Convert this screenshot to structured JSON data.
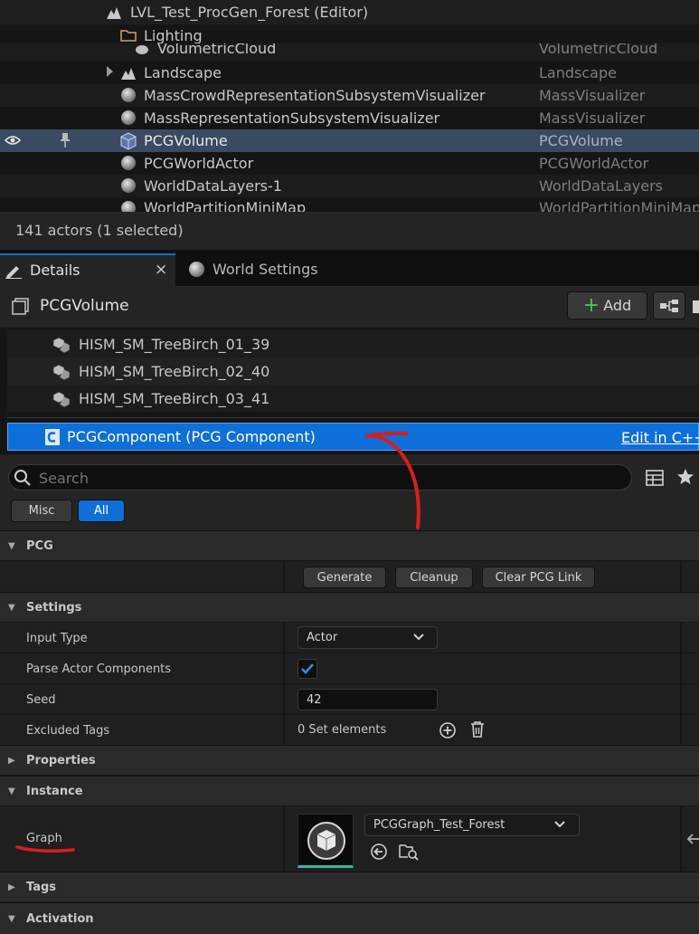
{
  "outliner": {
    "level_name": "LVL_Test_ProcGen_Forest (Editor)",
    "folder_name": "Lighting",
    "rows": [
      {
        "name": "VolumetricCloud",
        "type": "VolumetricCloud"
      },
      {
        "name": "Landscape",
        "type": "Landscape"
      },
      {
        "name": "MassCrowdRepresentationSubsystemVisualizer",
        "type": "MassVisualizer"
      },
      {
        "name": "MassRepresentationSubsystemVisualizer",
        "type": "MassVisualizer"
      },
      {
        "name": "PCGVolume",
        "type": "PCGVolume"
      },
      {
        "name": "PCGWorldActor",
        "type": "PCGWorldActor"
      },
      {
        "name": "WorldDataLayers-1",
        "type": "WorldDataLayers"
      },
      {
        "name": "WorldPartitionMiniMap",
        "type": "WorldPartitionMiniMap"
      }
    ],
    "status": "141 actors (1 selected)"
  },
  "tabs": {
    "details": "Details",
    "world_settings": "World Settings",
    "close": "×"
  },
  "details": {
    "actor_name": "PCGVolume",
    "add_label": "Add",
    "components": [
      "HISM_SM_TreeBirch_01_39",
      "HISM_SM_TreeBirch_02_40",
      "HISM_SM_TreeBirch_03_41"
    ],
    "selected_component": "PCGComponent (PCG Component)",
    "edit_cpp": "Edit in C++",
    "search_placeholder": "Search",
    "filters": [
      "Misc",
      "All"
    ]
  },
  "sections": {
    "pcg": {
      "label": "PCG",
      "buttons": [
        "Generate",
        "Cleanup",
        "Clear PCG Link"
      ]
    },
    "settings": {
      "label": "Settings",
      "input_type_label": "Input Type",
      "input_type_value": "Actor",
      "parse_label": "Parse Actor Components",
      "parse_checked": true,
      "seed_label": "Seed",
      "seed_value": "42",
      "excluded_label": "Excluded Tags",
      "excluded_value": "0 Set elements"
    },
    "properties": {
      "label": "Properties"
    },
    "instance": {
      "label": "Instance",
      "graph_label": "Graph",
      "graph_value": "PCGGraph_Test_Forest"
    },
    "tags": {
      "label": "Tags"
    },
    "activation": {
      "label": "Activation"
    }
  },
  "colors": {
    "selection_blue": "#0f6fd8",
    "annotation_red": "#d41f1f",
    "outliner_selected": "#394a61",
    "add_green": "#4fc24f"
  }
}
